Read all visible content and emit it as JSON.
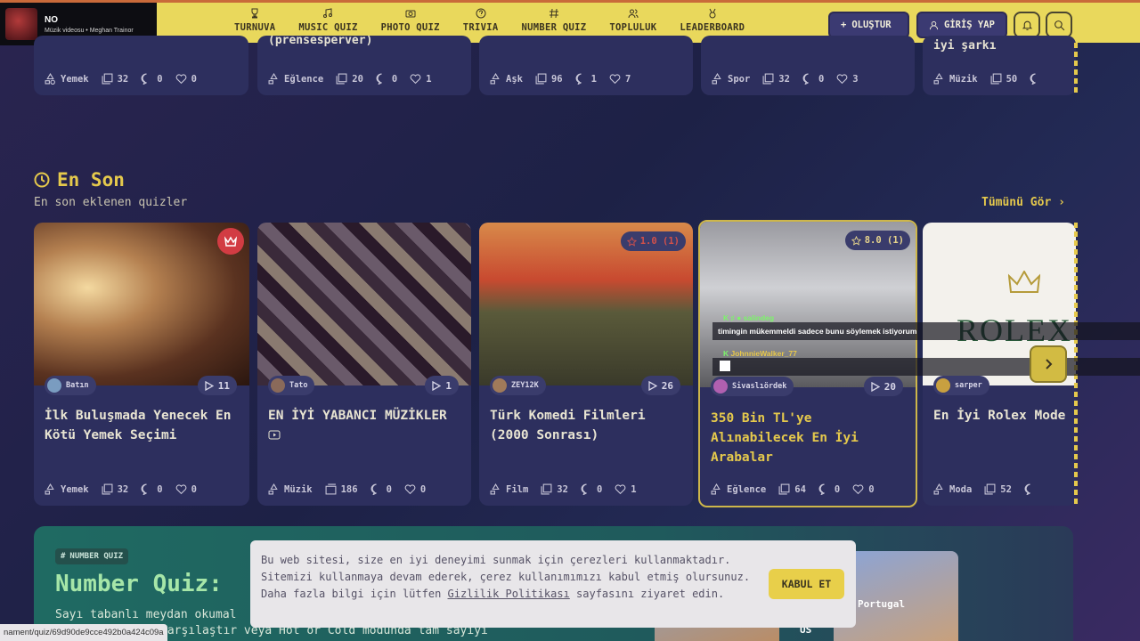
{
  "now_playing": {
    "title": "NO",
    "subtitle": "Müzik videosu • Meghan Trainor"
  },
  "nav": [
    {
      "label": "TURNUVA",
      "icon": "trophy-icon"
    },
    {
      "label": "MUSIC QUIZ",
      "icon": "music-icon"
    },
    {
      "label": "PHOTO QUIZ",
      "icon": "camera-icon"
    },
    {
      "label": "TRIVIA",
      "icon": "question-icon"
    },
    {
      "label": "NUMBER QUIZ",
      "icon": "hash-icon"
    },
    {
      "label": "TOPLULUK",
      "icon": "users-icon"
    },
    {
      "label": "LEADERBOARD",
      "icon": "medal-icon"
    }
  ],
  "header": {
    "create_label": "OLUŞTUR",
    "login_label": "GİRİŞ YAP"
  },
  "top_row": [
    {
      "title": "",
      "category": "Yemek",
      "questions": "32",
      "comments": "0",
      "likes": "0"
    },
    {
      "title": "(prensesperver)",
      "category": "Eğlence",
      "questions": "20",
      "comments": "0",
      "likes": "1"
    },
    {
      "title": "",
      "category": "Aşk",
      "questions": "96",
      "comments": "1",
      "likes": "7"
    },
    {
      "title": "",
      "category": "Spor",
      "questions": "32",
      "comments": "0",
      "likes": "3"
    },
    {
      "title": "iyi şarkı",
      "category": "Müzik",
      "questions": "50",
      "comments": "",
      "likes": ""
    }
  ],
  "section": {
    "title": "En Son",
    "subtitle": "En son eklenen quizler",
    "see_all": "Tümünü Gör"
  },
  "cards": [
    {
      "author": "Batın",
      "plays": "11",
      "rating": "",
      "title": "İlk Buluşmada Yenecek En Kötü Yemek Seçimi",
      "category": "Yemek",
      "questions": "32",
      "comments": "0",
      "likes": "0"
    },
    {
      "author": "Tato",
      "plays": "1",
      "rating": "",
      "title": "EN İYİ YABANCI MÜZİKLER",
      "category": "Müzik",
      "questions": "186",
      "comments": "0",
      "likes": "0"
    },
    {
      "author": "ZEY12K",
      "plays": "26",
      "rating": "1.0 (1)",
      "title": "Türk Komedi Filmleri (2000 Sonrası)",
      "category": "Film",
      "questions": "32",
      "comments": "0",
      "likes": "1"
    },
    {
      "author": "Sivaslıördek",
      "plays": "20",
      "rating": "8.0 (1)",
      "title": "350 Bin TL'ye Alınabilecek En İyi Arabalar",
      "category": "Eğlence",
      "questions": "64",
      "comments": "0",
      "likes": "0"
    },
    {
      "author": "sarper",
      "plays": "",
      "rating": "",
      "title": "En İyi Rolex Mode",
      "category": "Moda",
      "questions": "52",
      "comments": "",
      "likes": ""
    }
  ],
  "chat": [
    {
      "name": "salindeg",
      "message": "timingin mükemmeldi sadece bunu söylemek istiyorum"
    },
    {
      "name": "JohnnieWalker_77",
      "message": ""
    }
  ],
  "thumb_text": {
    "rolex": "ROLEX"
  },
  "number_quiz": {
    "badge": "NUMBER QUIZ",
    "title": "Number Quiz:",
    "desc_line1": "Sayı tabanlı meydan okumal",
    "desc_line2": "karşılaştır veya Hot or Cold modunda tam sayıyı",
    "img_label_1": "US",
    "img_label_2": "Portugal"
  },
  "cookie": {
    "text_before": "Bu web sitesi, size en iyi deneyimi sunmak için çerezleri kullanmaktadır. Sitemizi kullanmaya devam ederek, çerez kullanımımızı kabul etmiş olursunuz. Daha fazla bilgi için lütfen ",
    "link": "Gizlilik Politikası",
    "text_after": " sayfasını ziyaret edin.",
    "accept": "KABUL ET"
  },
  "status_url": "nament/quiz/69d90de9cce492b0a424c09a",
  "colors": {
    "accent": "#e5c94c",
    "topbar": "#e9d85c",
    "card": "#2d2f5e",
    "background": "#1d2146"
  }
}
